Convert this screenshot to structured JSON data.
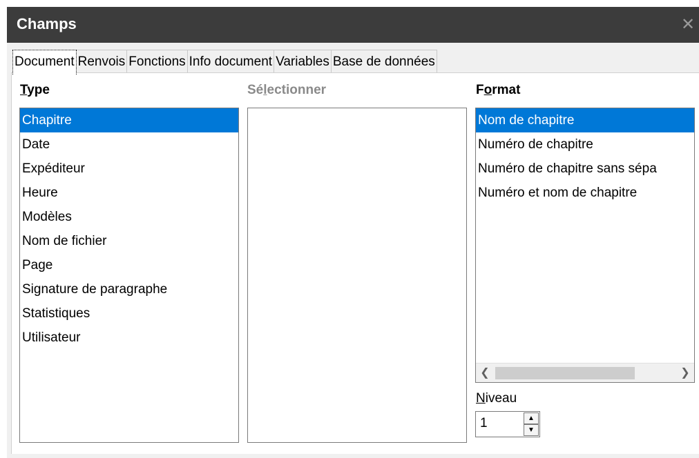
{
  "window": {
    "title": "Champs",
    "close_icon": "close-icon"
  },
  "tabs": [
    {
      "label": "Document",
      "active": true
    },
    {
      "label": "Renvois"
    },
    {
      "label": "Fonctions"
    },
    {
      "label": "Info document"
    },
    {
      "label": "Variables"
    },
    {
      "label": "Base de données"
    }
  ],
  "type": {
    "label_accel": "T",
    "label_rest": "ype",
    "items": [
      "Chapitre",
      "Date",
      "Expéditeur",
      "Heure",
      "Modèles",
      "Nom de fichier",
      "Page",
      "Signature de paragraphe",
      "Statistiques",
      "Utilisateur"
    ],
    "selected": "Chapitre"
  },
  "select": {
    "label_pre": "Sé",
    "label_accel": "l",
    "label_post": "ectionner"
  },
  "format": {
    "label_pre": "F",
    "label_accel": "o",
    "label_post": "rmat",
    "items": [
      "Nom de chapitre",
      "Numéro de chapitre",
      "Numéro de chapitre sans sépa",
      "Numéro et nom de chapitre"
    ],
    "selected": "Nom de chapitre"
  },
  "niveau": {
    "label_accel": "N",
    "label_rest": "iveau",
    "value": "1"
  },
  "colors": {
    "selection": "#0078d7",
    "titlebar": "#3c3c3c"
  }
}
